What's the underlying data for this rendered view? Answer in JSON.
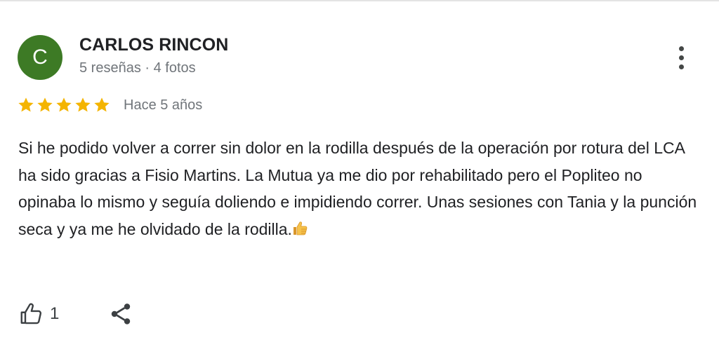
{
  "review": {
    "author": {
      "initial": "C",
      "name": "CARLOS RINCON",
      "meta": "5 reseñas · 4 fotos",
      "avatar_color": "#3d7a25"
    },
    "rating": 5,
    "rating_max": 5,
    "star_color": "#f4b400",
    "date": "Hace 5 años",
    "text": "Si he podido volver a correr sin dolor en la rodilla después de la operación por rotura del LCA ha sido gracias a Fisio Martins. La Mutua ya me dio por rehabilitado pero el Popliteo no opinaba lo mismo y seguía doliendo e impidiendo correr. Unas sesiones con Tania y la punción seca y ya me he olvidado de la rodilla.",
    "text_emoji": "thumbs-up-icon",
    "likes": "1",
    "icons": {
      "more": "more-vert-icon",
      "like": "thumb-up-outline-icon",
      "share": "share-icon",
      "star": "star-icon"
    }
  }
}
